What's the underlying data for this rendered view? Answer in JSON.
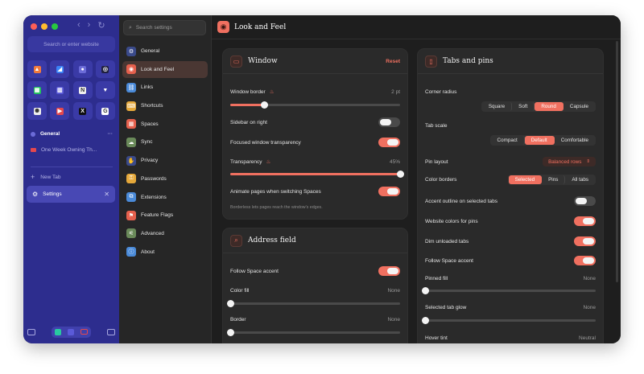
{
  "browser": {
    "url_placeholder": "Search or enter website",
    "favorites": [
      {
        "icon": "flame-app-icon",
        "color": "#f27a3c",
        "glyph": "▲"
      },
      {
        "icon": "linear-app-icon",
        "color": "#3b82f6",
        "glyph": "◢"
      },
      {
        "icon": "reddit-app-icon",
        "color": "#6b6bd8",
        "glyph": "●"
      },
      {
        "icon": "openai-app-icon",
        "color": "#202040",
        "glyph": "◎"
      },
      {
        "icon": "sheets-app-icon",
        "color": "#22c55e",
        "glyph": "▦"
      },
      {
        "icon": "trello-app-icon",
        "color": "#5a5ad8",
        "glyph": "▥"
      },
      {
        "icon": "notion-app-icon",
        "color": "#eeeeee",
        "glyph": "N"
      },
      {
        "icon": "vercel-app-icon",
        "color": "#3a3aa6",
        "glyph": "▼"
      },
      {
        "icon": "chatgpt-app-icon",
        "color": "#eeeeee",
        "glyph": "✺"
      },
      {
        "icon": "youtube-app-icon",
        "color": "#e5484d",
        "glyph": "▶"
      },
      {
        "icon": "x-app-icon",
        "color": "#111111",
        "glyph": "X"
      },
      {
        "icon": "google-app-icon",
        "color": "#ffffff",
        "glyph": "G"
      }
    ],
    "space_label": "General",
    "space_more": "···",
    "tab_title": "One Week Owning Th...",
    "new_tab_label": "New Tab",
    "settings_tab_label": "Settings"
  },
  "settings_nav": {
    "search_placeholder": "Search settings",
    "items": [
      {
        "label": "General",
        "icon": "gear-icon",
        "glyph": "⚙",
        "color": "#3a4a8a",
        "active": false
      },
      {
        "label": "Look and Feel",
        "icon": "palette-icon",
        "glyph": "◉",
        "color": "#e5604d",
        "active": true
      },
      {
        "label": "Links",
        "icon": "link-icon",
        "glyph": "⛓",
        "color": "#4a8ad8",
        "active": false
      },
      {
        "label": "Shortcuts",
        "icon": "keyboard-icon",
        "glyph": "⌨",
        "color": "#e5a83a",
        "active": false
      },
      {
        "label": "Spaces",
        "icon": "spaces-icon",
        "glyph": "▦",
        "color": "#e5604d",
        "active": false
      },
      {
        "label": "Sync",
        "icon": "cloud-icon",
        "glyph": "☁",
        "color": "#6a8a5a",
        "active": false
      },
      {
        "label": "Privacy",
        "icon": "hand-icon",
        "glyph": "✋",
        "color": "#3a4a8a",
        "active": false
      },
      {
        "label": "Passwords",
        "icon": "key-icon",
        "glyph": "⚿",
        "color": "#e5a83a",
        "active": false
      },
      {
        "label": "Extensions",
        "icon": "puzzle-icon",
        "glyph": "⧉",
        "color": "#4a8ad8",
        "active": false
      },
      {
        "label": "Feature Flags",
        "icon": "flag-icon",
        "glyph": "⚑",
        "color": "#e5604d",
        "active": false
      },
      {
        "label": "Advanced",
        "icon": "sliders-icon",
        "glyph": "⚟",
        "color": "#6a8a5a",
        "active": false
      },
      {
        "label": "About",
        "icon": "info-icon",
        "glyph": "ⓘ",
        "color": "#4a8ad8",
        "active": false
      }
    ]
  },
  "header": {
    "title": "Look and Feel"
  },
  "window_card": {
    "title": "Window",
    "reset_label": "Reset",
    "window_border_label": "Window border",
    "window_border_value": "2 pt",
    "window_border_level": 0.2,
    "sidebar_right_label": "Sidebar on right",
    "sidebar_right_on": false,
    "focused_transparency_label": "Focused window transparency",
    "focused_transparency_on": true,
    "transparency_label": "Transparency",
    "transparency_value": "45%",
    "transparency_level": 1.0,
    "animate_label": "Animate pages when switching Spaces",
    "animate_on": true,
    "hint": "Borderless lets pages reach the window's edges."
  },
  "address_card": {
    "title": "Address field",
    "follow_accent_label": "Follow Space accent",
    "follow_accent_on": true,
    "color_fill_label": "Color fill",
    "color_fill_value": "None",
    "border_label": "Border",
    "border_value": "None"
  },
  "tabs_card": {
    "title": "Tabs and pins",
    "corner_radius_label": "Corner radius",
    "corner_radius_options": [
      "Square",
      "Soft",
      "Round",
      "Capsule"
    ],
    "corner_radius_selected": "Round",
    "tab_scale_label": "Tab scale",
    "tab_scale_options": [
      "Compact",
      "Default",
      "Comfortable"
    ],
    "tab_scale_selected": "Default",
    "pin_layout_label": "Pin layout",
    "pin_layout_value": "Balanced rows",
    "color_borders_label": "Color borders",
    "color_borders_options": [
      "Selected",
      "Pins",
      "All tabs"
    ],
    "color_borders_selected": "Selected",
    "accent_outline_label": "Accent outline on selected tabs",
    "accent_outline_on": false,
    "website_colors_label": "Website colors for pins",
    "website_colors_on": true,
    "dim_unloaded_label": "Dim unloaded tabs",
    "dim_unloaded_on": true,
    "follow_space_label": "Follow Space accent",
    "follow_space_on": true,
    "pinned_fill_label": "Pinned fill",
    "pinned_fill_value": "None",
    "selected_glow_label": "Selected tab glow",
    "selected_glow_value": "None",
    "hover_tint_label": "Hover tint",
    "hover_tint_value": "Neutral"
  }
}
